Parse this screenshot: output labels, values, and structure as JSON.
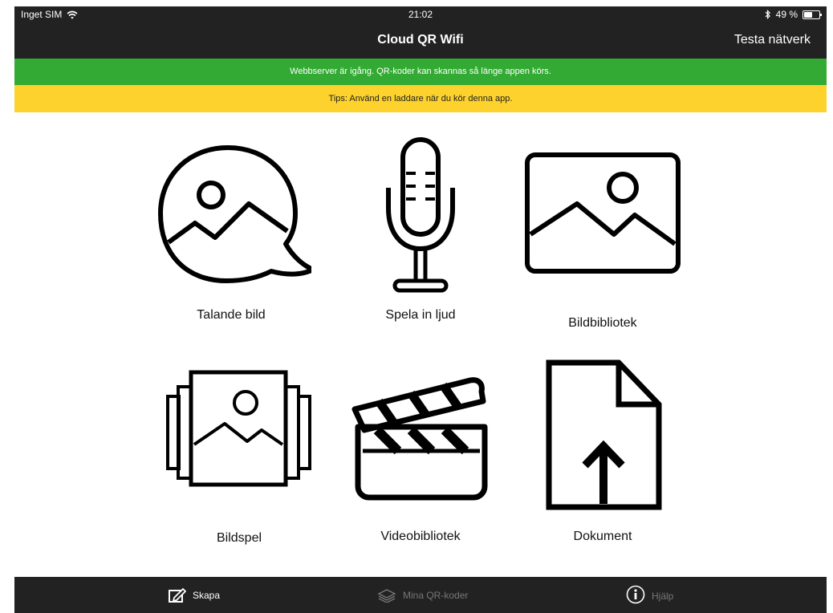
{
  "status_bar": {
    "carrier": "Inget SIM",
    "time": "21:02",
    "battery_text": "49 %"
  },
  "nav": {
    "title": "Cloud QR Wifi",
    "right_action": "Testa nätverk"
  },
  "banners": {
    "server": "Webbserver är igång. QR-koder kan skannas så länge appen körs.",
    "tip": "Tips: Använd en laddare när du kör denna app."
  },
  "tiles": [
    {
      "label": "Talande bild",
      "icon": "talking-image-icon"
    },
    {
      "label": "Spela in ljud",
      "icon": "microphone-icon"
    },
    {
      "label": "Bildbibliotek",
      "icon": "image-library-icon"
    },
    {
      "label": "Bildspel",
      "icon": "slideshow-icon"
    },
    {
      "label": "Videobibliotek",
      "icon": "clapperboard-icon"
    },
    {
      "label": "Dokument",
      "icon": "document-upload-icon"
    }
  ],
  "tab_bar": {
    "tabs": [
      {
        "label": "Skapa",
        "icon": "edit-icon",
        "active": true
      },
      {
        "label": "Mina QR-koder",
        "icon": "layers-icon",
        "active": false
      },
      {
        "label": "Hjälp",
        "icon": "info-icon",
        "active": false
      }
    ]
  },
  "colors": {
    "bars": "#222222",
    "banner_green": "#33aa33",
    "banner_yellow": "#fdd22c"
  }
}
